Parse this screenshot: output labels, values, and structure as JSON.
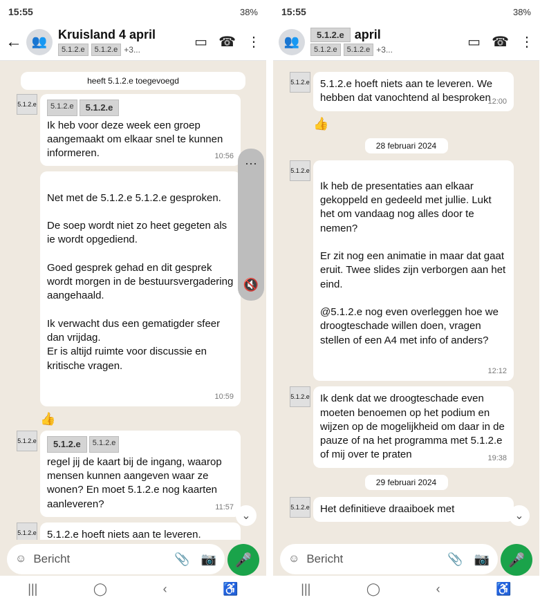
{
  "left": {
    "status": {
      "time": "15:55",
      "battery": "38%"
    },
    "header": {
      "title": "Kruisland 4 april",
      "subtitle_extra": "+3..."
    },
    "messages": [
      {
        "type": "system",
        "text": "heeft 5.1.2.e toegevoegd"
      },
      {
        "type": "bubble",
        "time": "10:56",
        "text": "Ik heb voor deze week een groep aangemaakt om elkaar snel te kunnen informeren."
      },
      {
        "type": "bubble",
        "time": "10:59",
        "text": "Net met de 5.1.2.e 5.1.2.e gesproken.\n\nDe soep wordt niet zo heet gegeten als ie wordt opgediend.\n\nGoed gesprek gehad en dit gesprek wordt morgen in de bestuursvergadering aangehaald.\n\nIk verwacht dus een gematigder sfeer dan vrijdag.\nEr is altijd ruimte voor discussie en kritische vragen."
      },
      {
        "type": "emoji",
        "text": "👍"
      },
      {
        "type": "bubble",
        "time": "11:57",
        "text": "regel jij de kaart bij de ingang, waarop mensen kunnen aangeven waar ze wonen? En moet 5.1.2.e nog kaarten aanleveren?"
      },
      {
        "type": "bubble",
        "time": "",
        "text": "5.1.2.e hoeft niets aan te leveren."
      }
    ],
    "input_placeholder": "Bericht"
  },
  "right": {
    "status": {
      "time": "15:55",
      "battery": "38%"
    },
    "header": {
      "title": "april",
      "subtitle_extra": "+3..."
    },
    "messages": [
      {
        "type": "bubble",
        "time": "12:00",
        "text": "5.1.2.e hoeft niets aan te leveren. We hebben dat vanochtend al besproken"
      },
      {
        "type": "emoji",
        "text": "👍"
      },
      {
        "type": "date",
        "text": "28 februari 2024"
      },
      {
        "type": "bubble",
        "time": "12:12",
        "text": "Ik heb de presentaties aan elkaar gekoppeld en gedeeld met jullie. Lukt het om vandaag nog alles door te nemen?\n\nEr zit nog een animatie in maar dat gaat eruit. Twee slides zijn verborgen aan het eind.\n\n@5.1.2.e nog even overleggen hoe we droogteschade willen doen, vragen stellen of een A4 met info of anders?"
      },
      {
        "type": "bubble",
        "time": "19:38",
        "text": "Ik denk dat we droogteschade even moeten benoemen op het podium en wijzen op de mogelijkheid om daar in de pauze of na het programma met 5.1.2.e of mij over te praten"
      },
      {
        "type": "date",
        "text": "29 februari 2024"
      },
      {
        "type": "bubble",
        "time": "",
        "text": "Het definitieve draaiboek met"
      }
    ],
    "input_placeholder": "Bericht"
  },
  "redacted_label": "5.1.2.e"
}
